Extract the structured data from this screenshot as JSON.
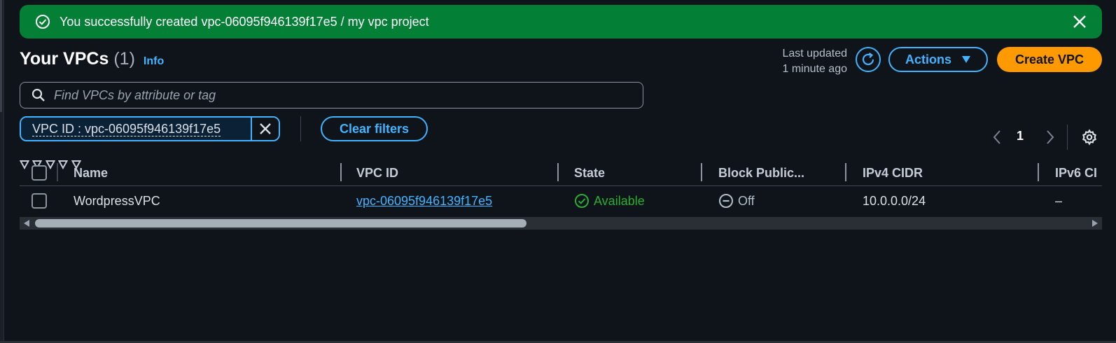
{
  "flash": {
    "message": "You successfully created vpc-06095f946139f17e5 / my vpc project",
    "color": "#037f36"
  },
  "header": {
    "title": "Your VPCs",
    "count": "(1)",
    "info_label": "Info",
    "last_updated_line1": "Last updated",
    "last_updated_line2": "1 minute ago",
    "actions_label": "Actions",
    "create_label": "Create VPC"
  },
  "search": {
    "placeholder": "Find VPCs by attribute or tag"
  },
  "filter": {
    "token_label": "VPC ID : vpc-06095f946139f17e5",
    "clear_label": "Clear filters"
  },
  "pagination": {
    "current_page": "1"
  },
  "table": {
    "columns": [
      "Name",
      "VPC ID",
      "State",
      "Block Public...",
      "IPv4 CIDR",
      "IPv6 CI"
    ],
    "rows": [
      {
        "name": "WordpressVPC",
        "vpc_id": "vpc-06095f946139f17e5",
        "state": "Available",
        "block_public": "Off",
        "ipv4_cidr": "10.0.0.0/24",
        "ipv6": "–"
      }
    ]
  },
  "colors": {
    "accent": "#42b4ff",
    "primary_button": "#ff9900",
    "success": "#29ad32",
    "background": "#0f141a"
  },
  "icons": [
    "check-circle-icon",
    "close-icon",
    "refresh-icon",
    "caret-down-icon",
    "search-icon",
    "chevron-left-icon",
    "chevron-right-icon",
    "settings-icon",
    "sort-icon",
    "minus-circle-icon"
  ]
}
